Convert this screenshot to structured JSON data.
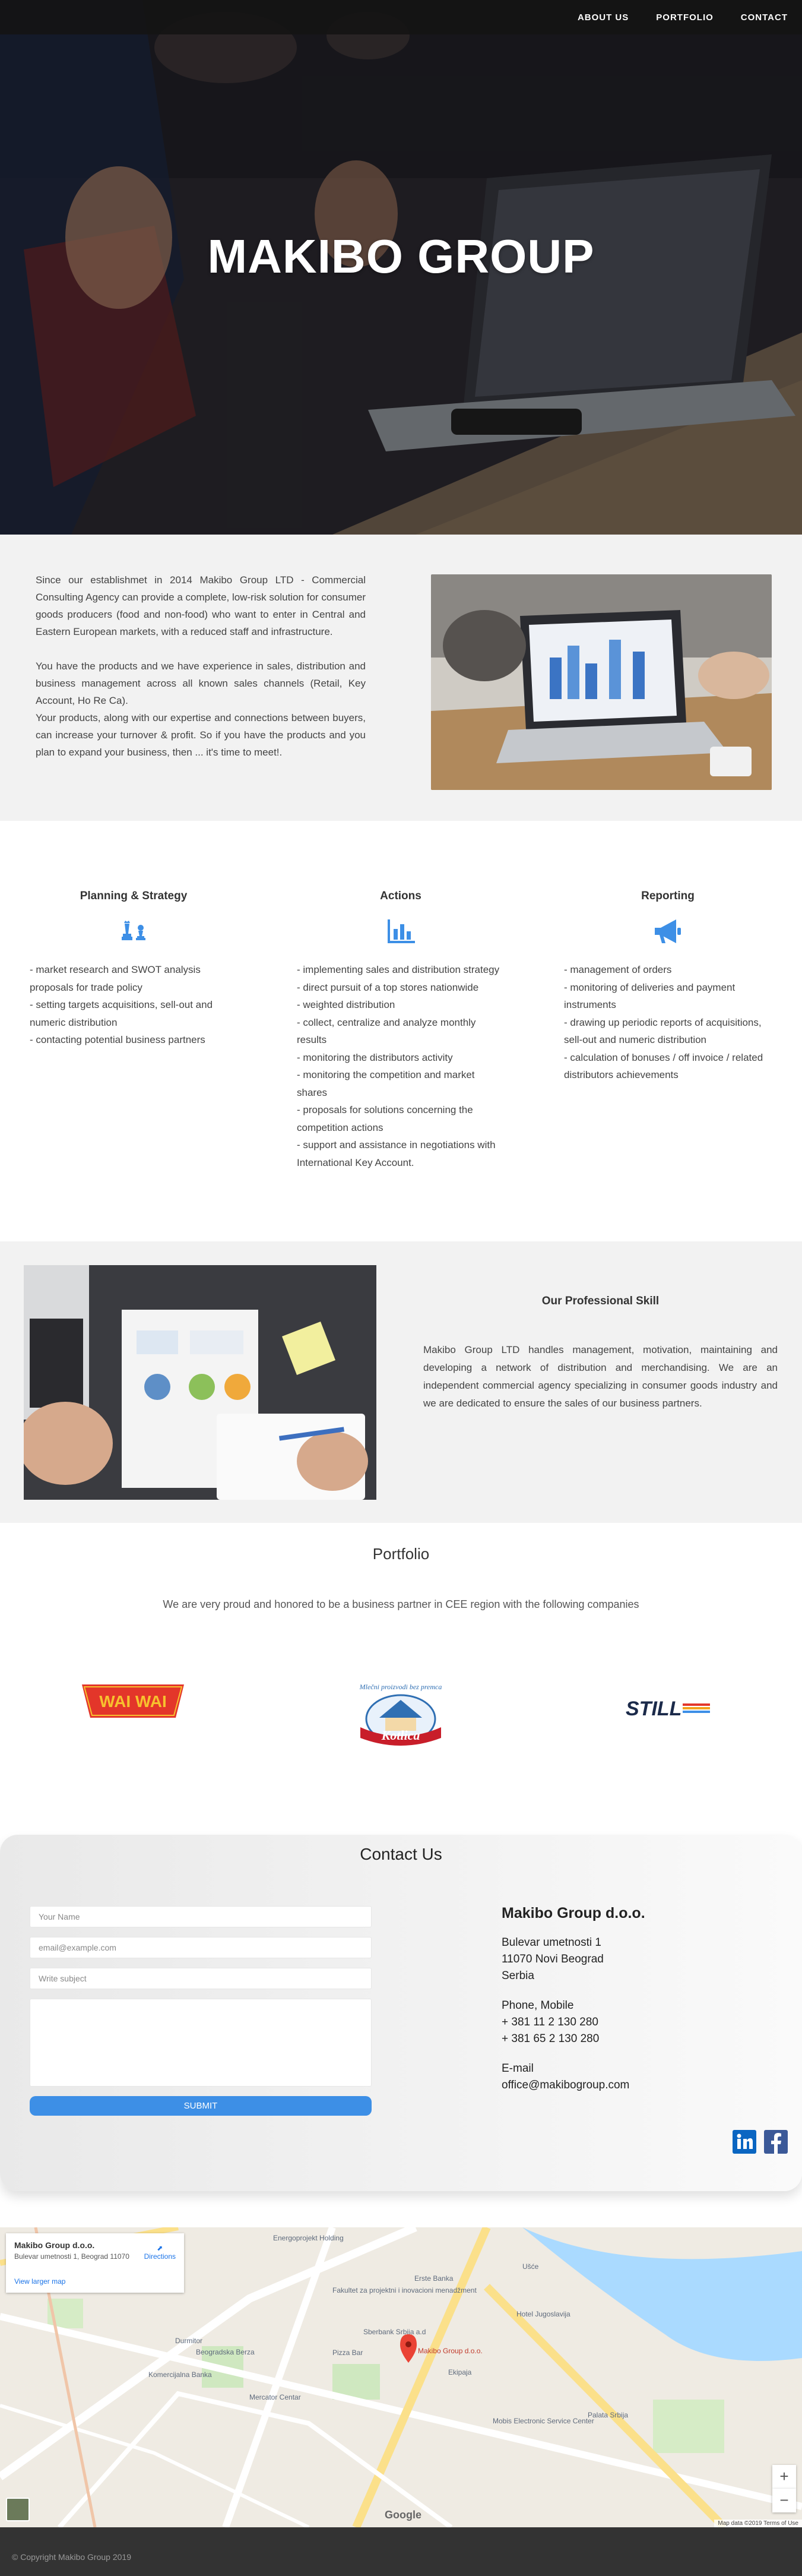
{
  "nav": {
    "items": [
      "ABOUT US",
      "PORTFOLIO",
      "CONTACT"
    ]
  },
  "hero": {
    "title": "MAKIBO GROUP"
  },
  "intro": {
    "paragraphs": [
      "Since our establishmet in 2014 Makibo Group LTD - Commercial Consulting Agency can provide a complete, low-risk solution for consumer goods producers (food and non-food) who want to enter in Central and Eastern European markets, with a reduced staff and infrastructure.",
      "You have the products and we have experience in sales, distribution and business management across all known sales channels (Retail, Key Account, Ho Re Ca).",
      "Your products, along with our expertise and connections between buyers, can increase your turnover & profit. So if you have the products and you plan to expand your business, then ... it's time to meet!."
    ]
  },
  "services": [
    {
      "title": "Planning & Strategy",
      "icon": "chess-icon",
      "items": [
        "- market research and SWOT analysis proposals for trade policy",
        "- setting targets acquisitions, sell-out and numeric distribution",
        "- contacting potential business partners"
      ]
    },
    {
      "title": "Actions",
      "icon": "bar-chart-icon",
      "items": [
        "- implementing sales and distribution strategy",
        "- direct pursuit of a top stores nationwide",
        "- weighted distribution",
        "- collect, centralize and analyze monthly results",
        "- monitoring the distributors activity",
        "- monitoring the competition and market shares",
        "- proposals for solutions concerning the competition actions",
        "- support and assistance in negotiations with International Key Account."
      ]
    },
    {
      "title": "Reporting",
      "icon": "megaphone-icon",
      "items": [
        "- management of orders",
        "- monitoring of deliveries and payment instruments",
        "- drawing up periodic reports of acquisitions, sell-out and numeric distribution",
        "- calculation of bonuses / off invoice / related distributors achievements"
      ]
    }
  ],
  "skill": {
    "title": "Our Professional Skill",
    "text": "Makibo Group LTD handles management, motivation, maintaining and developing a network of distribution and merchandising. We are an independent commercial agency specializing in consumer goods industry and we are dedicated to ensure the sales of our business partners."
  },
  "portfolio": {
    "title": "Portfolio",
    "lead": "We are very proud and honored to be a business partner in CEE region with the following companies",
    "logos": [
      {
        "text": "WAI WAI",
        "color": "#e3362a"
      },
      {
        "text": "Kotlica",
        "tagline": "Mlečni proizvodi bez premca",
        "color": "#c81e2a"
      },
      {
        "text": "STILL",
        "color": "#1b2a4a"
      }
    ]
  },
  "contact": {
    "title": "Contact Us",
    "form": {
      "name_placeholder": "Your Name",
      "email_placeholder": "email@example.com",
      "subject_placeholder": "Write subject",
      "submit_label": "SUBMIT"
    },
    "company": "Makibo Group d.o.o.",
    "address": [
      "Bulevar umetnosti 1",
      "11070 Novi Beograd",
      "Serbia"
    ],
    "phone_label": "Phone, Mobile",
    "phones": [
      "+ 381 11 2 130 280",
      "+ 381 65 2 130 280"
    ],
    "email_label": "E-mail",
    "email": "office@makibogroup.com"
  },
  "map": {
    "place": "Makibo Group d.o.o.",
    "address": "Bulevar umetnosti 1, Beograd 11070",
    "directions": "Directions",
    "view_larger": "View larger map",
    "marker_label": "Makibo Group d.o.o.",
    "attribution": "Map data ©2019   Terms of Use",
    "google": "Google",
    "labels": [
      "Energoprojekt Holding",
      "Erste Banka",
      "Sberbank Srbija a.d",
      "Mercator Centar",
      "Komercijalna Banka",
      "Beogradska Berza",
      "Hotel Jugoslavija",
      "Mobis Electronic Service Center",
      "Pizza Bar",
      "Durmitor",
      "Ekipaja",
      "Fakultet za projektni i inovacioni menadžment",
      "Palata Srbija",
      "Ušće"
    ]
  },
  "footer": {
    "copyright": "© Copyright Makibo Group 2019"
  }
}
